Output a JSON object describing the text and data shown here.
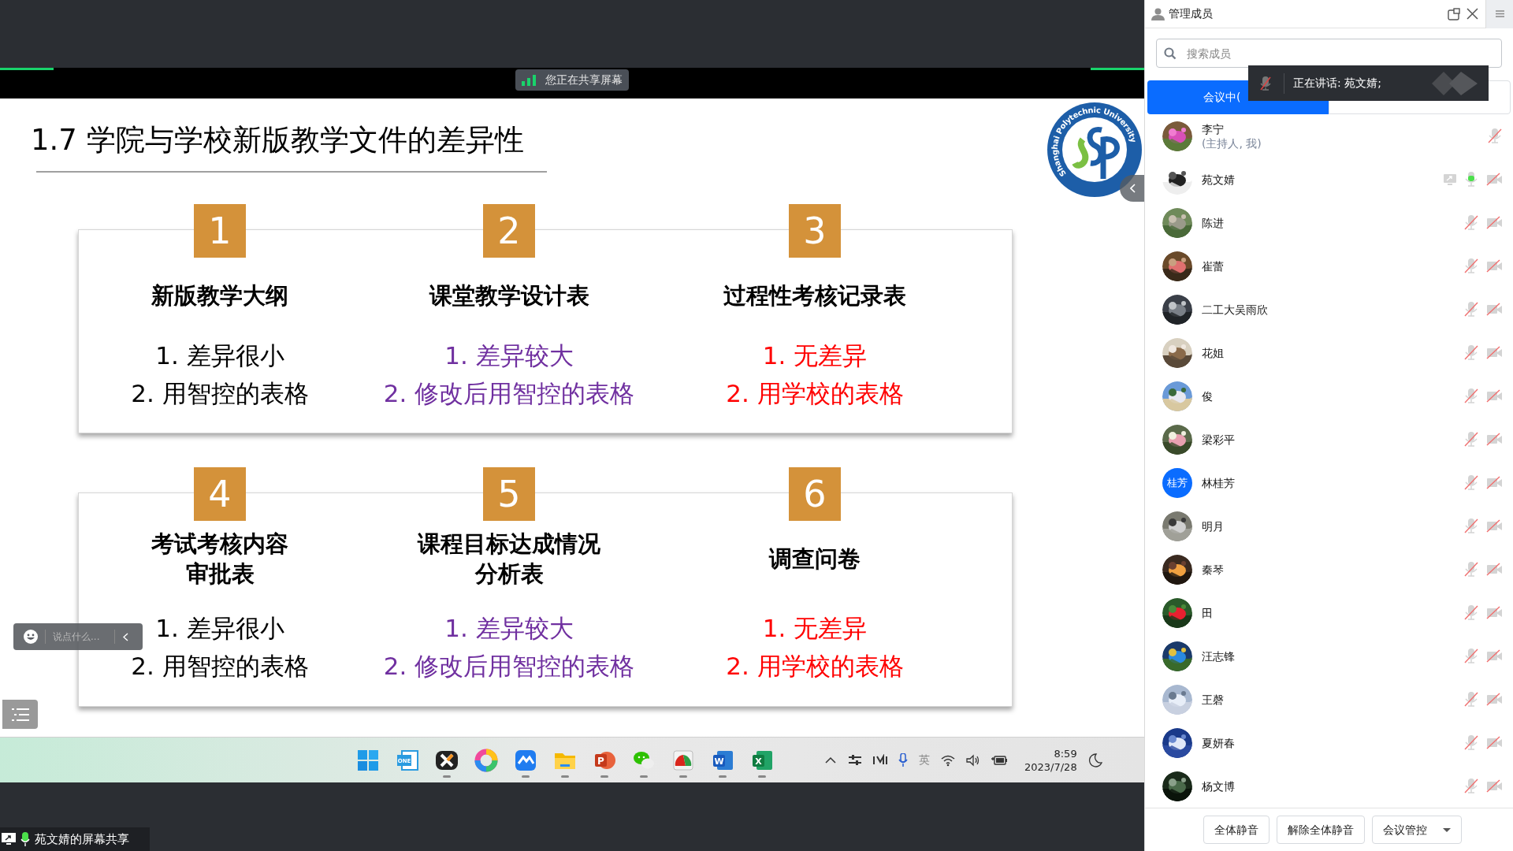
{
  "share_banner": {
    "text": "您正在共享屏幕"
  },
  "slide": {
    "title": "1.7 学院与学校新版教学文件的差异性",
    "logo_text": "Shanghai Polytechnic University",
    "cards": [
      {
        "items": [
          {
            "number": "1",
            "heading": [
              "新版教学大纲"
            ],
            "color": "#000000",
            "lines": [
              "1. 差异很小",
              "2. 用智控的表格"
            ]
          },
          {
            "number": "2",
            "heading": [
              "课堂教学设计表"
            ],
            "color": "#7030a0",
            "lines": [
              "1. 差异较大",
              "2. 修改后用智控的表格"
            ]
          },
          {
            "number": "3",
            "heading": [
              "过程性考核记录表"
            ],
            "color": "#ff0000",
            "lines": [
              "1. 无差异",
              "2. 用学校的表格"
            ]
          }
        ]
      },
      {
        "items": [
          {
            "number": "4",
            "heading": [
              "考试考核内容",
              "审批表"
            ],
            "color": "#000000",
            "lines": [
              "1. 差异很小",
              "2. 用智控的表格"
            ]
          },
          {
            "number": "5",
            "heading": [
              "课程目标达成情况",
              "分析表"
            ],
            "color": "#7030a0",
            "lines": [
              "1. 差异较大",
              "2. 修改后用智控的表格"
            ]
          },
          {
            "number": "6",
            "heading": [
              "调查问卷"
            ],
            "color": "#ff0000",
            "lines": [
              "1. 无差异",
              "2. 用学校的表格"
            ]
          }
        ]
      }
    ]
  },
  "chat_input": {
    "placeholder": "说点什么..."
  },
  "taskbar": {
    "apps": [
      {
        "kind": "windows",
        "running": false
      },
      {
        "kind": "onenote",
        "glyph": "ONE",
        "running": false
      },
      {
        "kind": "xmind",
        "running": true
      },
      {
        "kind": "ring",
        "running": false
      },
      {
        "kind": "meeting",
        "running": true
      },
      {
        "kind": "folder",
        "running": true
      },
      {
        "kind": "powerpoint",
        "glyph": "P",
        "running": true
      },
      {
        "kind": "wechat",
        "running": true
      },
      {
        "kind": "speedo",
        "running": true
      },
      {
        "kind": "word",
        "glyph": "W",
        "running": true
      },
      {
        "kind": "excel",
        "glyph": "X",
        "running": true
      }
    ],
    "ime": "英",
    "time": "8:59",
    "date": "2023/7/28"
  },
  "share_label": "苑文婧的屏幕共享",
  "panel": {
    "title": "管理成员",
    "search": {
      "placeholder": "搜索成员"
    },
    "tabs": [
      {
        "label": "会议中(",
        "selected": true
      },
      {
        "selected": false
      }
    ],
    "speaking_toast": {
      "text": "正在讲话: 苑文婧;"
    },
    "members": [
      {
        "name": "李宁",
        "role": "(主持人, 我)",
        "sharing": false,
        "muted": true,
        "camera_off": false
      },
      {
        "name": "苑文婧",
        "sharing": true,
        "muted": false,
        "camera_off": true
      },
      {
        "name": "陈进",
        "sharing": false,
        "muted": true,
        "camera_off": true
      },
      {
        "name": "崔蕾",
        "sharing": false,
        "muted": true,
        "camera_off": true
      },
      {
        "name": "二工大吴雨欣",
        "sharing": false,
        "muted": true,
        "camera_off": true
      },
      {
        "name": "花姐",
        "sharing": false,
        "muted": true,
        "camera_off": true
      },
      {
        "name": "俊",
        "sharing": false,
        "muted": true,
        "camera_off": true
      },
      {
        "name": "梁彩平",
        "sharing": false,
        "muted": true,
        "camera_off": true
      },
      {
        "name": "林桂芳",
        "avatar": {
          "kind": "initials",
          "text": "桂芳"
        },
        "sharing": false,
        "muted": true,
        "camera_off": true
      },
      {
        "name": "明月",
        "sharing": false,
        "muted": true,
        "camera_off": true
      },
      {
        "name": "秦琴",
        "sharing": false,
        "muted": true,
        "camera_off": true
      },
      {
        "name": "田",
        "sharing": false,
        "muted": true,
        "camera_off": true
      },
      {
        "name": "汪志锋",
        "sharing": false,
        "muted": true,
        "camera_off": true
      },
      {
        "name": "王磬",
        "sharing": false,
        "muted": true,
        "camera_off": true
      },
      {
        "name": "夏妍春",
        "sharing": false,
        "muted": true,
        "camera_off": true
      },
      {
        "name": "杨文博",
        "sharing": false,
        "muted": true,
        "camera_off": true
      }
    ],
    "buttons": [
      {
        "label": "全体静音",
        "kind": "plain"
      },
      {
        "label": "解除全体静音",
        "kind": "plain"
      },
      {
        "label": "会议管控",
        "kind": "dropdown"
      }
    ]
  }
}
